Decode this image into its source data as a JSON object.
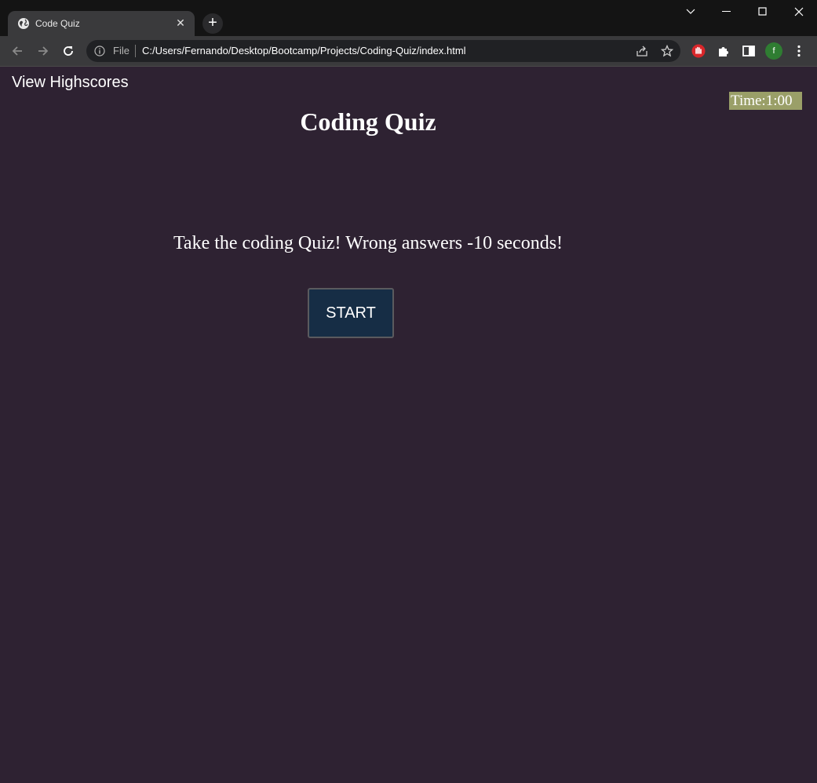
{
  "browser": {
    "tab_title": "Code Quiz",
    "tab_close": "✕",
    "new_tab": "+",
    "address_scheme": "File",
    "address_url": "C:/Users/Fernando/Desktop/Bootcamp/Projects/Coding-Quiz/index.html",
    "profile_initial": "f",
    "icons": [
      "globe-icon",
      "close-icon",
      "plus-icon",
      "chevron-down-icon",
      "minimize-icon",
      "maximize-icon",
      "window-close-icon",
      "back-arrow-icon",
      "forward-arrow-icon",
      "reload-icon",
      "info-icon",
      "share-icon",
      "star-icon",
      "stop-hand-extension-icon",
      "puzzle-extensions-icon",
      "side-panel-icon",
      "more-menu-icon"
    ]
  },
  "page": {
    "highscores_link": "View Highscores",
    "timer": "Time:1:00",
    "title": "Coding Quiz",
    "instructions": "Take the coding Quiz! Wrong answers -10 seconds!",
    "start_button": "START"
  },
  "colors": {
    "page_background": "#2e2232",
    "timer_background": "#9a9f68",
    "start_button_background": "#162d45",
    "profile_avatar": "#2f7d32",
    "extension_red": "#d9262a"
  }
}
